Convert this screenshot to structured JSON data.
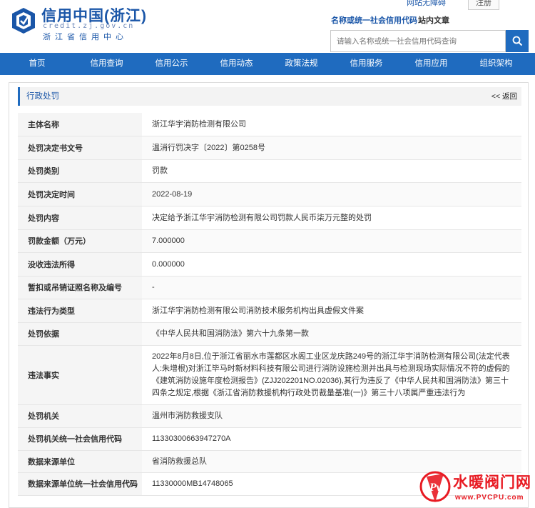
{
  "header": {
    "brand_cn": "信用中国(浙江)",
    "brand_url": "credit.zj.gov.cn",
    "brand_sub": "浙江省信用中心",
    "accessibility_link": "网站无障碍",
    "register_button": "注册",
    "search_tab_code": "名称或统一社会信用代码",
    "search_tab_site": "站内文章",
    "search_placeholder": "请输入名称或统一社会信用代码查询"
  },
  "nav": {
    "items": [
      "首页",
      "信用查询",
      "信用公示",
      "信用动态",
      "政策法规",
      "信用服务",
      "信用应用",
      "组织架构"
    ]
  },
  "panel": {
    "title": "行政处罚",
    "back": "<< 返回"
  },
  "record": {
    "rows": [
      {
        "key": "主体名称",
        "value": "浙江华宇消防检测有限公司"
      },
      {
        "key": "处罚决定书文号",
        "value": "温消行罚决字〔2022〕第0258号"
      },
      {
        "key": "处罚类别",
        "value": "罚款"
      },
      {
        "key": "处罚决定时间",
        "value": "2022-08-19"
      },
      {
        "key": "处罚内容",
        "value": "决定给予浙江华宇消防检测有限公司罚款人民币柒万元整的处罚"
      },
      {
        "key": "罚款金额（万元）",
        "value": "7.000000"
      },
      {
        "key": "没收违法所得",
        "value": "0.000000"
      },
      {
        "key": "暂扣或吊销证照名称及编号",
        "value": "-"
      },
      {
        "key": "违法行为类型",
        "value": "浙江华宇消防检测有限公司消防技术服务机构出具虚假文件案"
      },
      {
        "key": "处罚依据",
        "value": "《中华人民共和国消防法》第六十九条第一款"
      },
      {
        "key": "违法事实",
        "value": "2022年8月8日,位于浙江省丽水市莲都区水阁工业区龙庆路249号的浙江华宇消防检测有限公司(法定代表人:朱增根)对浙江毕马时新材料科技有限公司进行消防设施检测并出具与检测现场实际情况不符的虚假的《建筑消防设施年度检测报告》(ZJJ202201NO.02036),其行为违反了《中华人民共和国消防法》第三十四条之规定,根据《浙江省消防救援机构行政处罚裁量基准(一)》第三十八项属严重违法行为"
      },
      {
        "key": "处罚机关",
        "value": "温州市消防救援支队"
      },
      {
        "key": "处罚机关统一社会信用代码",
        "value": "11330300663947270A"
      },
      {
        "key": "数据来源单位",
        "value": "省消防救援总队"
      },
      {
        "key": "数据来源单位统一社会信用代码",
        "value": "11330000MB14748065"
      }
    ]
  },
  "watermark": {
    "text": "水暖阀门网",
    "url": "www.PVCPU.com"
  },
  "colors": {
    "brand_blue": "#1f6bbf",
    "watermark_red": "#e81b23"
  }
}
